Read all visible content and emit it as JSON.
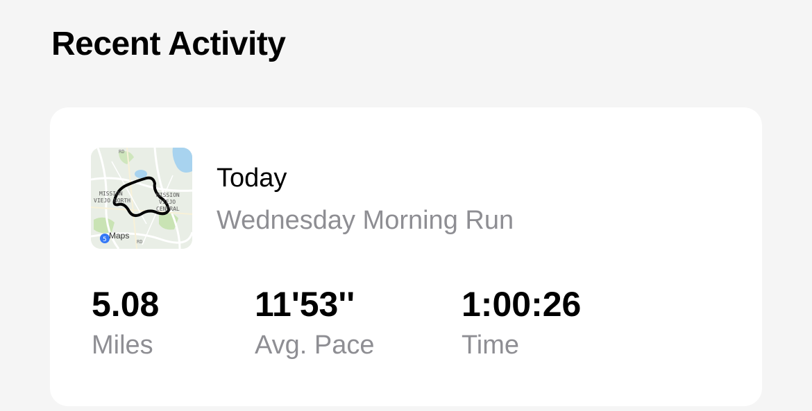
{
  "section": {
    "title": "Recent Activity"
  },
  "activity": {
    "date": "Today",
    "name": "Wednesday Morning Run",
    "map": {
      "label_north_1": "MISSION",
      "label_north_2": "VIEJO NORTH",
      "label_central_1": "MISSION",
      "label_central_2": "VIEJO",
      "label_central_3": "CENTRAL",
      "road_label_top": "RD",
      "road_label_bottom": "RD",
      "attribution": "Maps"
    },
    "stats": [
      {
        "value": "5.08",
        "label": "Miles"
      },
      {
        "value": "11'53''",
        "label": "Avg. Pace"
      },
      {
        "value": "1:00:26",
        "label": "Time"
      }
    ]
  }
}
